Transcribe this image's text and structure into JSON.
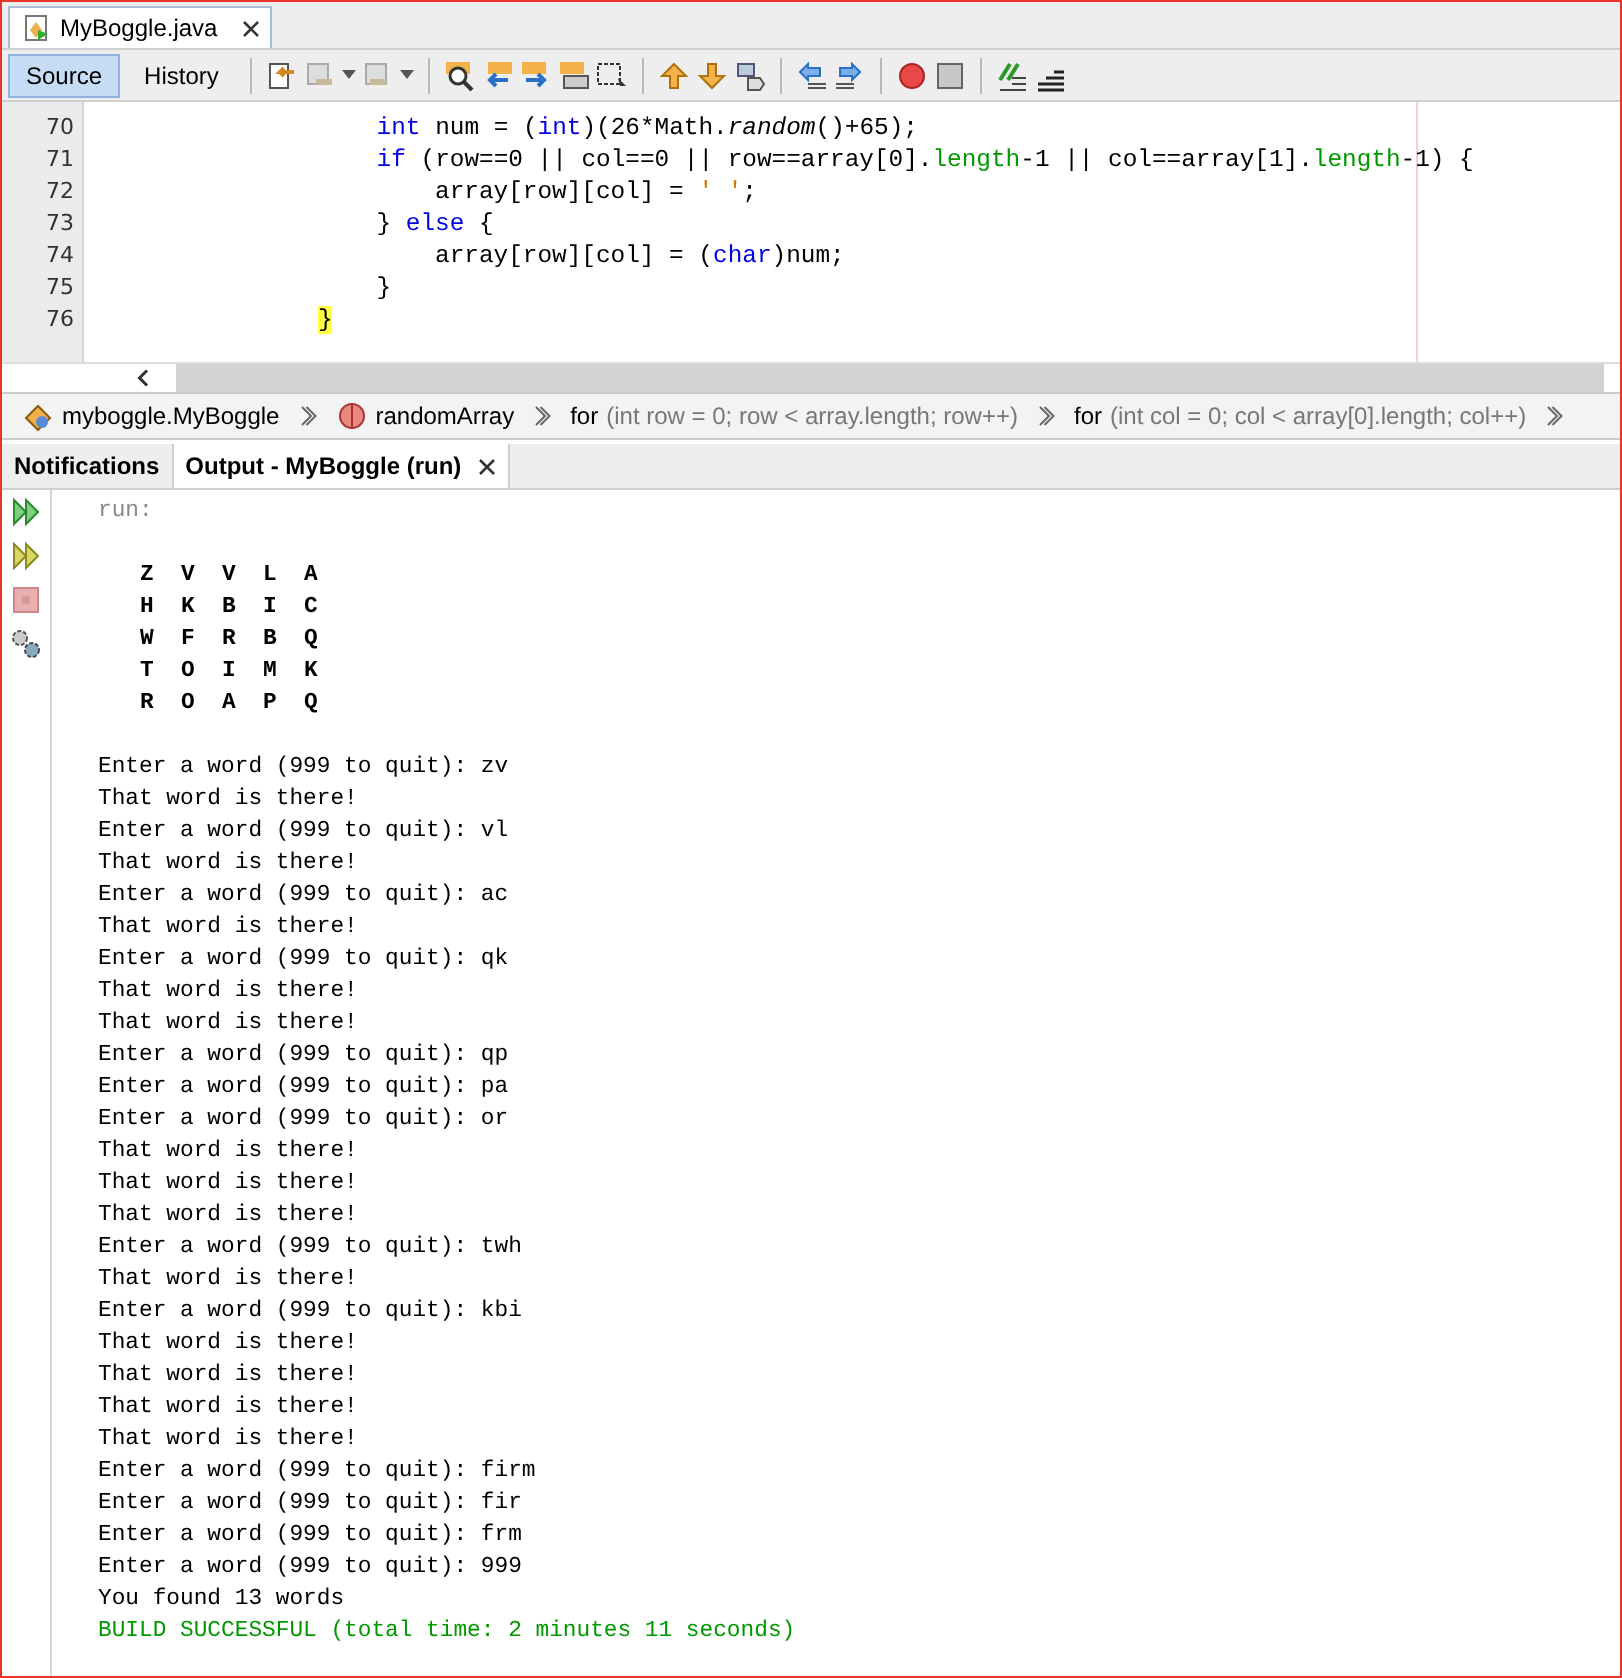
{
  "editor_tab": {
    "title": "MyBoggle.java",
    "selected": true
  },
  "view_tabs": [
    {
      "label": "Source",
      "selected": true
    },
    {
      "label": "History",
      "selected": false
    }
  ],
  "code": [
    {
      "number": "70",
      "segments": [
        {
          "text": "                    int",
          "kind": "keyword"
        },
        {
          "text": " num = (",
          "kind": "plain"
        },
        {
          "text": "int",
          "kind": "keyword"
        },
        {
          "text": ")(26*Math.",
          "kind": "plain"
        },
        {
          "text": "random",
          "kind": "italic"
        },
        {
          "text": "()+65);",
          "kind": "plain"
        }
      ]
    },
    {
      "number": "71",
      "segments": [
        {
          "text": "                    if",
          "kind": "keyword"
        },
        {
          "text": " (row==0 || col==0 || row==array[0].",
          "kind": "plain"
        },
        {
          "text": "length",
          "kind": "field"
        },
        {
          "text": "-1 || col==array[1].",
          "kind": "plain"
        },
        {
          "text": "length",
          "kind": "field"
        },
        {
          "text": "-1) {",
          "kind": "plain"
        }
      ]
    },
    {
      "number": "72",
      "segments": [
        {
          "text": "                        array[row][col] = ",
          "kind": "plain"
        },
        {
          "text": "' '",
          "kind": "char"
        },
        {
          "text": ";",
          "kind": "plain"
        }
      ]
    },
    {
      "number": "73",
      "segments": [
        {
          "text": "                    } ",
          "kind": "plain"
        },
        {
          "text": "else",
          "kind": "keyword"
        },
        {
          "text": " {",
          "kind": "plain"
        }
      ]
    },
    {
      "number": "74",
      "segments": [
        {
          "text": "                        array[row][col] = (",
          "kind": "plain"
        },
        {
          "text": "char",
          "kind": "keyword"
        },
        {
          "text": ")num;",
          "kind": "plain"
        }
      ]
    },
    {
      "number": "75",
      "segments": [
        {
          "text": "                    }",
          "kind": "plain"
        }
      ]
    },
    {
      "number": "76",
      "segments": [
        {
          "text": "                }",
          "kind": "match"
        }
      ]
    }
  ],
  "breadcrumbs": [
    {
      "label": "myboggle.MyBoggle",
      "kind": "class"
    },
    {
      "label": "randomArray",
      "kind": "method"
    },
    {
      "label": "for",
      "detail": "(int row = 0; row < array.length; row++)",
      "kind": "loop"
    },
    {
      "label": "for",
      "detail": "(int col = 0; col < array[0].length; col++)",
      "kind": "loop"
    }
  ],
  "panel_tabs": [
    {
      "label": "Notifications",
      "selected": false,
      "closable": false
    },
    {
      "label": "Output - MyBoggle (run)",
      "selected": true,
      "closable": true
    }
  ],
  "output": [
    {
      "kind": "text",
      "lines": [
        {
          "text": "run:",
          "kind": "dim"
        }
      ]
    },
    {
      "kind": "grid",
      "lines": [
        {
          "text": "Z  V  V  L  A",
          "kind": "normal"
        },
        {
          "text": "H  K  B  I  C",
          "kind": "normal"
        },
        {
          "text": "W  F  R  B  Q",
          "kind": "normal"
        },
        {
          "text": "T  O  I  M  K",
          "kind": "normal"
        },
        {
          "text": "R  O  A  P  Q",
          "kind": "normal"
        }
      ]
    },
    {
      "kind": "text",
      "lines": [
        {
          "text": "Enter a word (999 to quit): zv",
          "kind": "normal"
        },
        {
          "text": "That word is there!",
          "kind": "normal"
        },
        {
          "text": "Enter a word (999 to quit): vl",
          "kind": "normal"
        },
        {
          "text": "That word is there!",
          "kind": "normal"
        },
        {
          "text": "Enter a word (999 to quit): ac",
          "kind": "normal"
        },
        {
          "text": "That word is there!",
          "kind": "normal"
        },
        {
          "text": "Enter a word (999 to quit): qk",
          "kind": "normal"
        },
        {
          "text": "That word is there!",
          "kind": "normal"
        },
        {
          "text": "That word is there!",
          "kind": "normal"
        },
        {
          "text": "Enter a word (999 to quit): qp",
          "kind": "normal"
        },
        {
          "text": "Enter a word (999 to quit): pa",
          "kind": "normal"
        },
        {
          "text": "Enter a word (999 to quit): or",
          "kind": "normal"
        },
        {
          "text": "That word is there!",
          "kind": "normal"
        },
        {
          "text": "That word is there!",
          "kind": "normal"
        },
        {
          "text": "That word is there!",
          "kind": "normal"
        },
        {
          "text": "Enter a word (999 to quit): twh",
          "kind": "normal"
        },
        {
          "text": "That word is there!",
          "kind": "normal"
        },
        {
          "text": "Enter a word (999 to quit): kbi",
          "kind": "normal"
        },
        {
          "text": "That word is there!",
          "kind": "normal"
        },
        {
          "text": "That word is there!",
          "kind": "normal"
        },
        {
          "text": "That word is there!",
          "kind": "normal"
        },
        {
          "text": "That word is there!",
          "kind": "normal"
        },
        {
          "text": "Enter a word (999 to quit): firm",
          "kind": "normal"
        },
        {
          "text": "Enter a word (999 to quit): fir",
          "kind": "normal"
        },
        {
          "text": "Enter a word (999 to quit): frm",
          "kind": "normal"
        },
        {
          "text": "Enter a word (999 to quit): 999",
          "kind": "normal"
        },
        {
          "text": "You found 13 words",
          "kind": "normal"
        },
        {
          "text": "BUILD SUCCESSFUL (total time: 2 minutes 11 seconds)",
          "kind": "success"
        }
      ]
    }
  ]
}
